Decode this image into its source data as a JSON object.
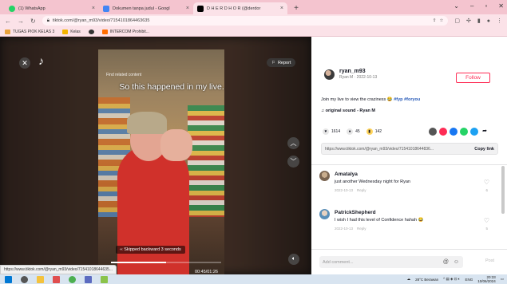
{
  "browser": {
    "tabs": [
      {
        "title": "(1) WhatsApp",
        "icon": "whatsapp-icon",
        "color": "#25d366",
        "active": false
      },
      {
        "title": "Dokumen tanpa judul - Googl",
        "icon": "google-docs-icon",
        "color": "#4285f4",
        "active": false
      },
      {
        "title": "D H E R D H O R (@derdor",
        "icon": "tiktok-icon",
        "color": "#000000",
        "active": true
      }
    ],
    "new_tab": "+",
    "url": "tiktok.com/@ryan_m93/video/7154101864463635",
    "bookmarks": [
      {
        "label": "TUGAS PIOK KELAS 3",
        "color": "#e8a23b"
      },
      {
        "label": "Kelas",
        "color": "#f4b400"
      },
      {
        "label": "",
        "color": "#333333"
      },
      {
        "label": "INTERCOM Prohibit...",
        "color": "#ff6d00"
      }
    ]
  },
  "video": {
    "related": "Find related content",
    "caption": "So this happened in my live...",
    "skipped": "Skipped backward 3 seconds",
    "timecode": "00:45/01:26",
    "progress": 0.5,
    "report_label": "Report",
    "status_url": "https://www.tiktok.com/@ryan_m93/video/71541018644635..."
  },
  "post": {
    "username": "ryan_m93",
    "display_date": "Ryan M · 2022-10-13",
    "follow_label": "Follow",
    "description_text": "Join my live to view the craziness",
    "tags": "#fyp #foryou",
    "sound": "original sound - Ryan M",
    "likes": "1614",
    "comments": "45",
    "saves": "142",
    "link": "https://www.tiktok.com/@ryan_m93/video/71541018644836...",
    "copy_label": "Copy link"
  },
  "comments": [
    {
      "name": "Amatalya",
      "text": "just another Wednesday night for Ryan",
      "date": "2022-10-13",
      "reply": "Reply",
      "likes": "6",
      "color": "#a58a6e"
    },
    {
      "name": "PatrickShepherd",
      "text": "I wish I had this level of Confidence hahah",
      "date": "2022-10-13",
      "reply": "Reply",
      "likes": "5",
      "color": "#6aa3c8"
    }
  ],
  "comment_input": {
    "placeholder": "Add comment...",
    "post_label": "Post"
  },
  "taskbar": {
    "weather": "28°C Berawan",
    "lang": "ENG",
    "time": "20:33",
    "date": "10/06/2024"
  }
}
